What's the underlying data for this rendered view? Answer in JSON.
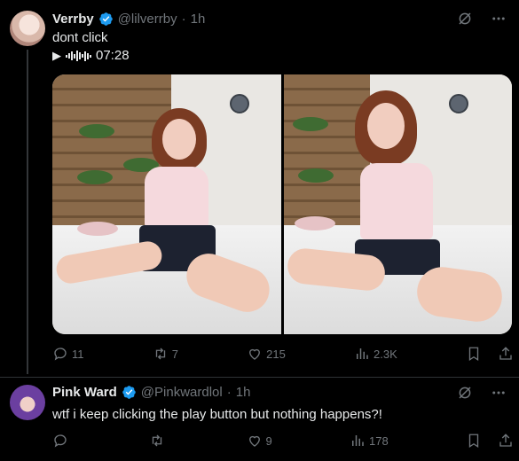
{
  "tweets": [
    {
      "display_name": "Verrby",
      "handle": "@lilverrby",
      "separator": "·",
      "time": "1h",
      "text_line1": "dont click",
      "play_glyph": "▶",
      "duration": "07:28",
      "icons": {
        "grok": "grok-icon",
        "more": "more-icon"
      },
      "stats": {
        "replies": "11",
        "reposts": "7",
        "likes": "215",
        "views": "2.3K"
      }
    },
    {
      "display_name": "Pink Ward",
      "handle": "@Pinkwardlol",
      "separator": "·",
      "time": "1h",
      "text": "wtf i keep clicking the play button but nothing happens?!",
      "stats": {
        "replies": "",
        "reposts": "",
        "likes": "9",
        "views": "178"
      }
    }
  ],
  "colors": {
    "background": "#000000",
    "text": "#e7e9ea",
    "muted": "#71767b",
    "verified": "#1d9bf0",
    "divider": "#2f3336"
  }
}
